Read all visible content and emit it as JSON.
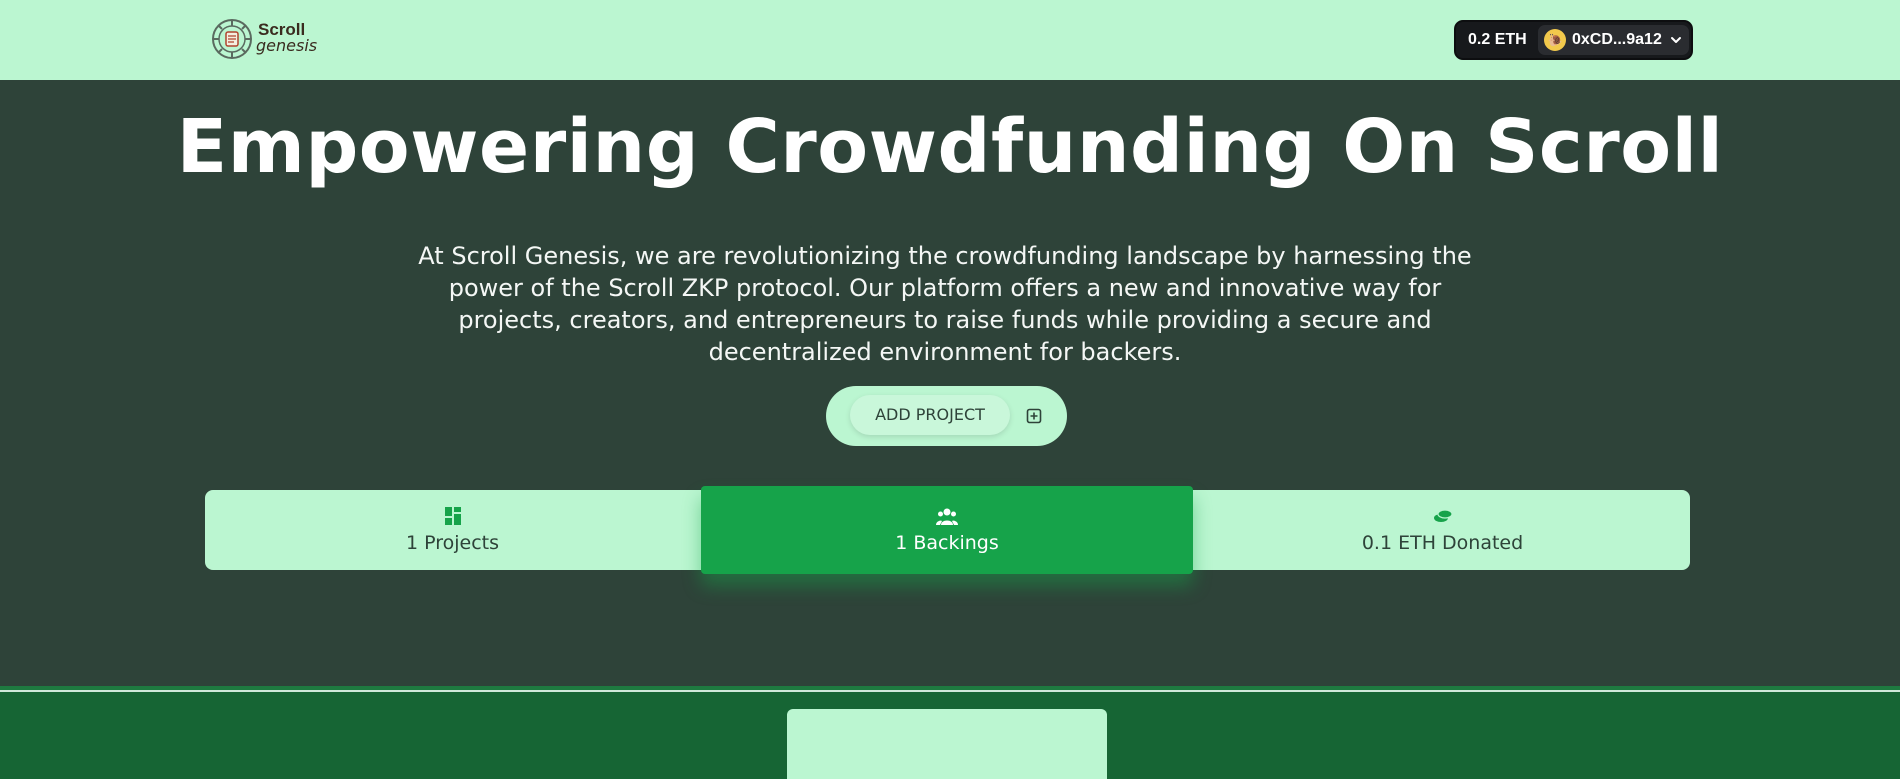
{
  "header": {
    "logo": {
      "line1": "Scroll",
      "line2": "genesis"
    },
    "wallet": {
      "balance": "0.2 ETH",
      "address": "0xCD...9a12"
    }
  },
  "hero": {
    "title": "Empowering Crowdfunding On Scroll",
    "description": "At Scroll Genesis, we are revolutionizing the crowdfunding landscape by harnessing the power of the Scroll ZKP protocol. Our platform offers a new and innovative way for projects, creators, and entrepreneurs to raise funds while providing a secure and decentralized environment for backers.",
    "add_project_label": "ADD PROJECT"
  },
  "stats": [
    {
      "label": "1 Projects",
      "icon": "dashboard-icon"
    },
    {
      "label": "1 Backings",
      "icon": "users-icon"
    },
    {
      "label": "0.1 ETH Donated",
      "icon": "coins-icon"
    }
  ],
  "colors": {
    "header_bg": "#bbf6d1",
    "hero_bg": "#2e4339",
    "accent": "#16a34a",
    "lower_bg": "#166534"
  }
}
